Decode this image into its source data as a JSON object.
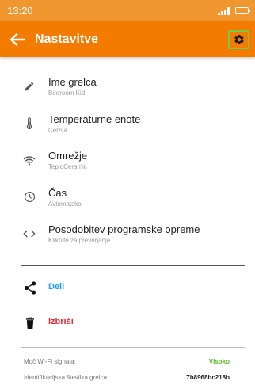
{
  "status_bar": {
    "time": "13:20"
  },
  "header": {
    "title": "Nastavitve"
  },
  "settings": [
    {
      "label": "Ime grelca",
      "value": "Bedroom Kid",
      "icon": "pencil-icon"
    },
    {
      "label": "Temperaturne enote",
      "value": "Celzija",
      "icon": "thermometer-icon"
    },
    {
      "label": "Omrežje",
      "value": "TeploCeramic",
      "icon": "wifi-icon"
    },
    {
      "label": "Čas",
      "value": "Avtomatsko",
      "icon": "clock-icon"
    },
    {
      "label": "Posodobitev programske opreme",
      "value": "Kliknite za preverjanje",
      "icon": "code-icon"
    }
  ],
  "actions": {
    "share": {
      "label": "Deli",
      "color": "#1e9be6",
      "icon": "share-icon"
    },
    "delete": {
      "label": "Izbriši",
      "color": "#e0303a",
      "icon": "trash-icon"
    }
  },
  "info": {
    "signal_label": "Moč Wi-Fi signala:",
    "signal_value": "Visoko",
    "signal_color": "#5cb82e",
    "id_label": "Identifikacijska številka grelca:",
    "id_value": "7b8968bc218b"
  },
  "colors": {
    "status_bar": "#f0982f",
    "app_bar": "#f27b00",
    "highlight": "#7ac943"
  }
}
